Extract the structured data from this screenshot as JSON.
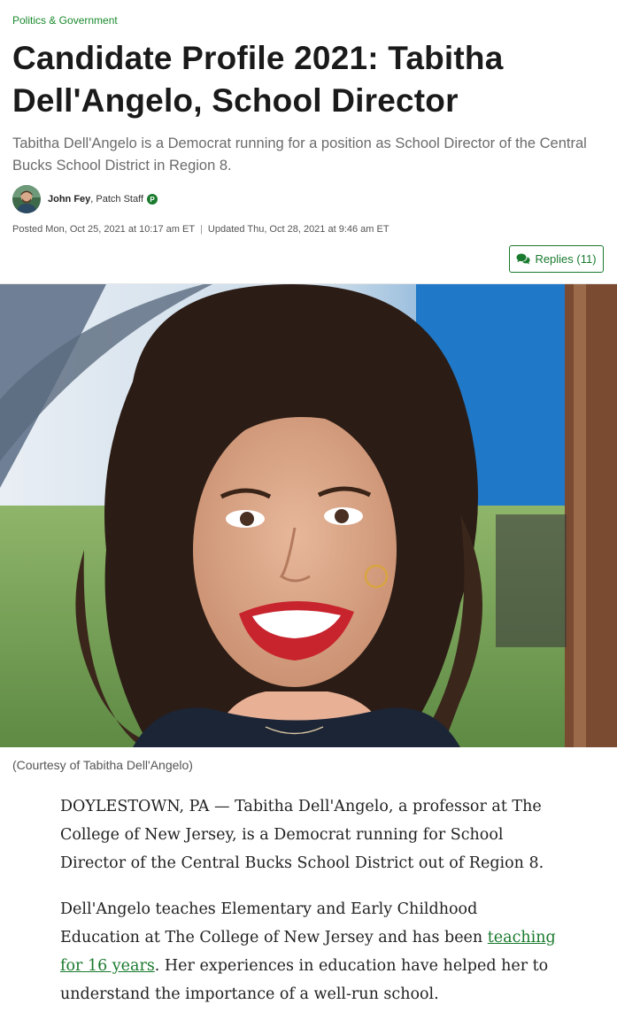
{
  "article": {
    "category": "Politics & Government",
    "title": "Candidate Profile 2021: Tabitha Dell'Angelo, School Director",
    "subtitle": "Tabitha Dell'Angelo is a Democrat running for a position as School Director of the Central Bucks School District in Region 8.",
    "author": {
      "name": "John Fey",
      "role": ", Patch Staff",
      "badge": "P"
    },
    "posted": "Posted Mon, Oct 25, 2021 at 10:17 am ET",
    "separator": "|",
    "updated": "Updated Thu, Oct 28, 2021 at 9:46 am ET",
    "replies_label": "Replies (11)",
    "image_caption": "(Courtesy of Tabitha Dell'Angelo)",
    "paragraphs": {
      "p1": "DOYLESTOWN, PA — Tabitha Dell'Angelo, a professor at The College of New Jersey, is a Democrat running for School Director of the Central Bucks School District out of Region 8.",
      "p2_before": "Dell'Angelo teaches Elementary and Early Childhood Education at The College of New Jersey and has been ",
      "p2_link": "teaching for 16 years",
      "p2_after": ". Her experiences in education have helped her to understand the importance of a well-run school."
    }
  },
  "colors": {
    "accent": "#1a7a2e",
    "category": "#1a8a2e"
  },
  "icons": {
    "replies": "chat-bubbles-icon",
    "badge": "patch-badge-icon"
  }
}
